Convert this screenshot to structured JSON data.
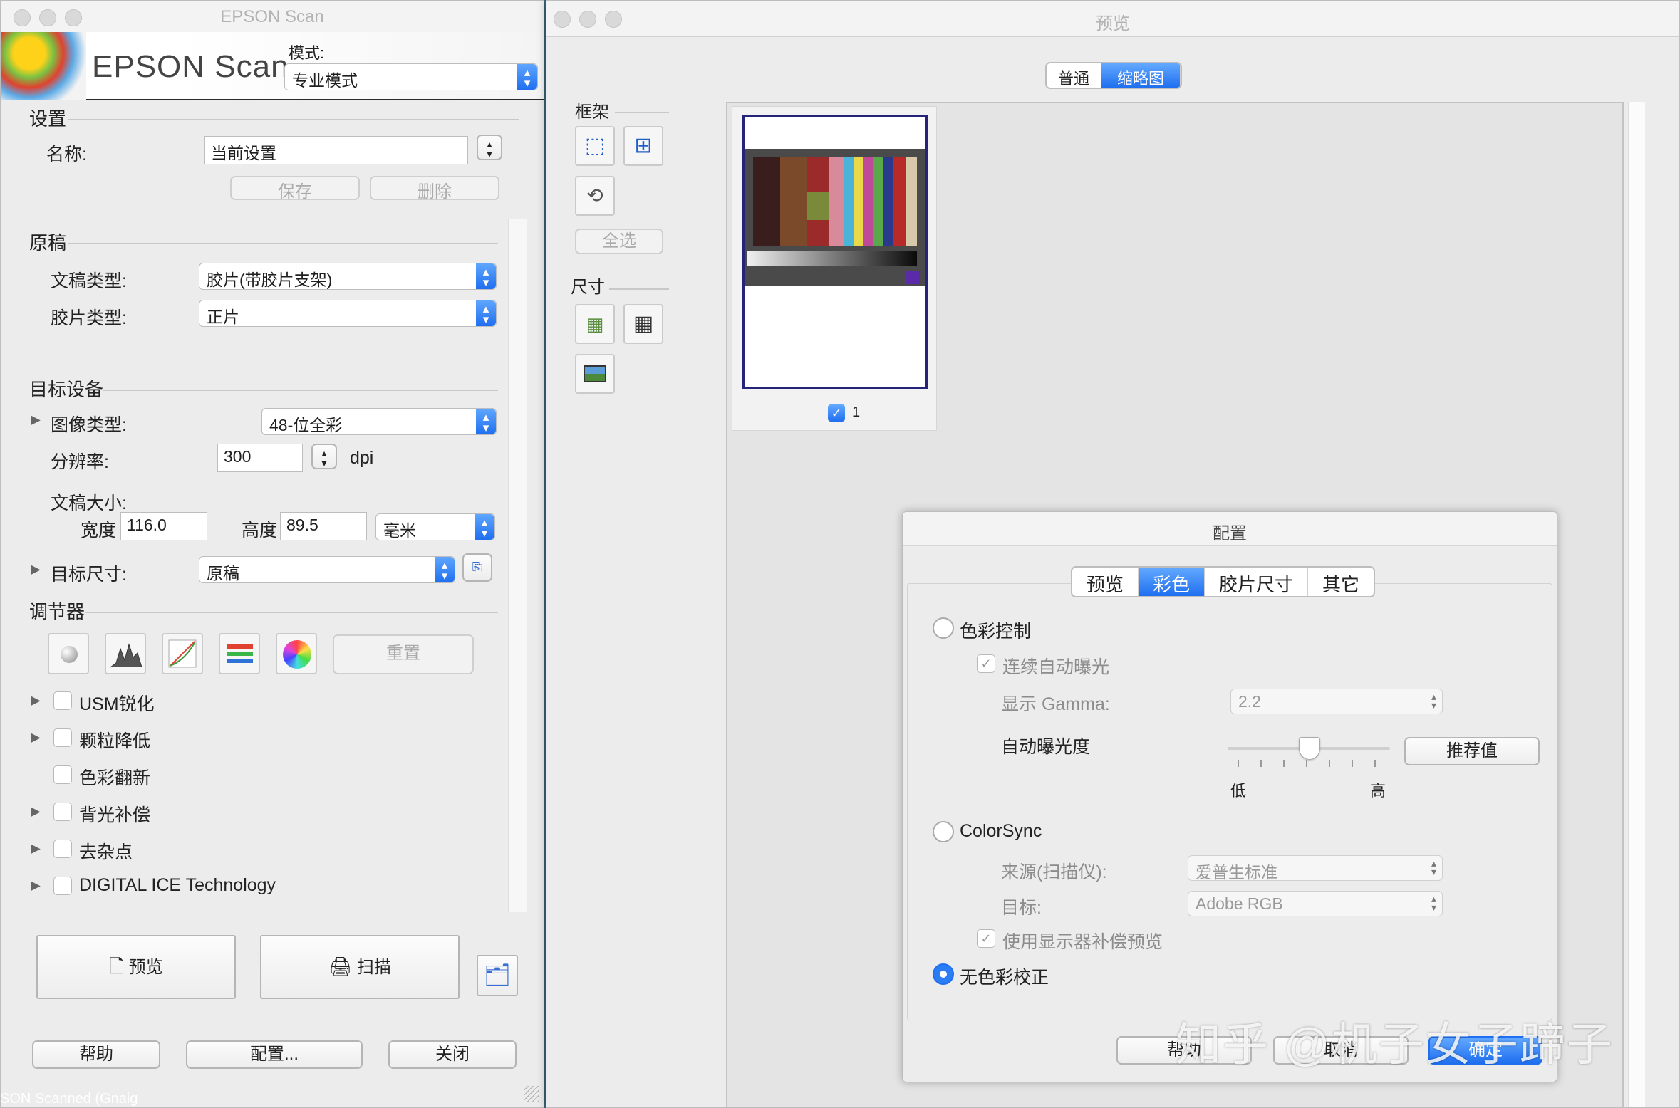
{
  "main_window": {
    "title": "EPSON Scan",
    "logo_text": "EPSON Scan",
    "mode_label": "模式:",
    "mode_value": "专业模式",
    "settings": {
      "section": "设置",
      "name_label": "名称:",
      "name_value": "当前设置",
      "save": "保存",
      "delete": "删除"
    },
    "original": {
      "section": "原稿",
      "doc_type_label": "文稿类型:",
      "doc_type_value": "胶片(带胶片支架)",
      "film_type_label": "胶片类型:",
      "film_type_value": "正片"
    },
    "target": {
      "section": "目标设备",
      "image_type_label": "图像类型:",
      "image_type_value": "48-位全彩",
      "resolution_label": "分辨率:",
      "resolution_value": "300",
      "resolution_unit": "dpi",
      "doc_size_label": "文稿大小:",
      "width_label": "宽度",
      "width_value": "116.0",
      "height_label": "高度",
      "height_value": "89.5",
      "unit_value": "毫米",
      "target_size_label": "目标尺寸:",
      "target_size_value": "原稿"
    },
    "adjust": {
      "section": "调节器",
      "reset": "重置",
      "options": [
        "USM锐化",
        "颗粒降低",
        "色彩翻新",
        "背光补偿",
        "去杂点",
        "DIGITAL ICE Technology"
      ]
    },
    "preview_btn": "预览",
    "scan_btn": "扫描",
    "help_btn": "帮助",
    "config_btn": "配置...",
    "close_btn": "关闭"
  },
  "preview_window": {
    "title": "预览",
    "tab_normal": "普通",
    "tab_thumb": "缩略图",
    "frame_section": "框架",
    "select_all": "全选",
    "size_section": "尺寸",
    "thumb_number": "1"
  },
  "config_dialog": {
    "title": "配置",
    "tabs": [
      "预览",
      "彩色",
      "胶片尺寸",
      "其它"
    ],
    "color_control": "色彩控制",
    "continuous_ae": "连续自动曝光",
    "gamma_label": "显示 Gamma:",
    "gamma_value": "2.2",
    "auto_exposure_label": "自动曝光度",
    "recommend_btn": "推荐值",
    "low": "低",
    "high": "高",
    "colorsync": "ColorSync",
    "source_label": "来源(扫描仪):",
    "source_value": "爱普生标准",
    "target_label": "目标:",
    "target_value": "Adobe RGB",
    "monitor_comp": "使用显示器补偿预览",
    "no_color_correction": "无色彩校正",
    "help_btn": "帮助",
    "cancel_btn": "取消",
    "ok_btn": "确定"
  },
  "watermark": "知乎 @机子女子蹄子",
  "desktop_text": "SON Scanned (Gnaig"
}
